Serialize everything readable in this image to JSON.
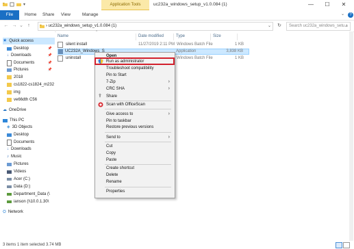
{
  "window": {
    "title": "uc232a_windows_setup_v1.0.084 (1)",
    "app_tools": "Application Tools",
    "controls": {
      "minimize": "—",
      "maximize": "☐",
      "close": "✕"
    }
  },
  "ribbon": {
    "file": "File",
    "tabs": [
      "Home",
      "Share",
      "View",
      "Manage"
    ]
  },
  "address": {
    "path": "›  uc232a_windows_setup_v1.0.084 (1)",
    "search_placeholder": "Search uc232a_windows_setu..."
  },
  "nav": {
    "quick_access": "Quick access",
    "items": [
      "Desktop",
      "Downloads",
      "Documents",
      "Pictures",
      "2018",
      "cs1822-cs1824_m232",
      "img",
      "ve66dth C56",
      "OneDrive",
      "This PC",
      "3D Objects",
      "Desktop",
      "Documents",
      "Downloads",
      "Music",
      "Pictures",
      "Videos",
      "Acer (C:)",
      "Data (D:)",
      "Department_Data (\\",
      "ianson (\\\\10.0.1.30\\",
      "Network"
    ]
  },
  "columns": {
    "name": "Name",
    "date": "Date modified",
    "type": "Type",
    "size": "Size"
  },
  "files": [
    {
      "name": "silent install",
      "date": "11/27/2019 2:11 PM",
      "type": "Windows Batch File",
      "size": "1 KB"
    },
    {
      "name": "UC232A_Windows_S",
      "date": "",
      "type": "Application",
      "size": "3,838 KB"
    },
    {
      "name": "uninstall",
      "date": "",
      "type": "Windows Batch File",
      "size": "1 KB"
    }
  ],
  "context_menu": {
    "items": [
      {
        "label": "Open",
        "bold": true
      },
      {
        "label": "Run as administrator"
      },
      {
        "label": "Troubleshoot compatibility"
      },
      {
        "label": "Pin to Start"
      },
      {
        "label": "7-Zip",
        "submenu": true
      },
      {
        "label": "CRC SHA",
        "submenu": true
      },
      {
        "label": "Share"
      },
      {
        "label": "Scan with OfficeScan"
      },
      {
        "label": "Give access to",
        "submenu": true
      },
      {
        "label": "Pin to taskbar"
      },
      {
        "label": "Restore previous versions"
      },
      {
        "label": "Send to",
        "submenu": true
      },
      {
        "label": "Cut"
      },
      {
        "label": "Copy"
      },
      {
        "label": "Paste"
      },
      {
        "label": "Create shortcut"
      },
      {
        "label": "Delete"
      },
      {
        "label": "Rename"
      },
      {
        "label": "Properties"
      }
    ]
  },
  "status": {
    "text": "3 items    1 item selected  3.74 MB"
  },
  "colors": {
    "accent": "#1a6fc4",
    "selection": "#cce8ff",
    "highlight_box": "#d21f2b",
    "app_tools_bg": "#fbe9a8"
  }
}
